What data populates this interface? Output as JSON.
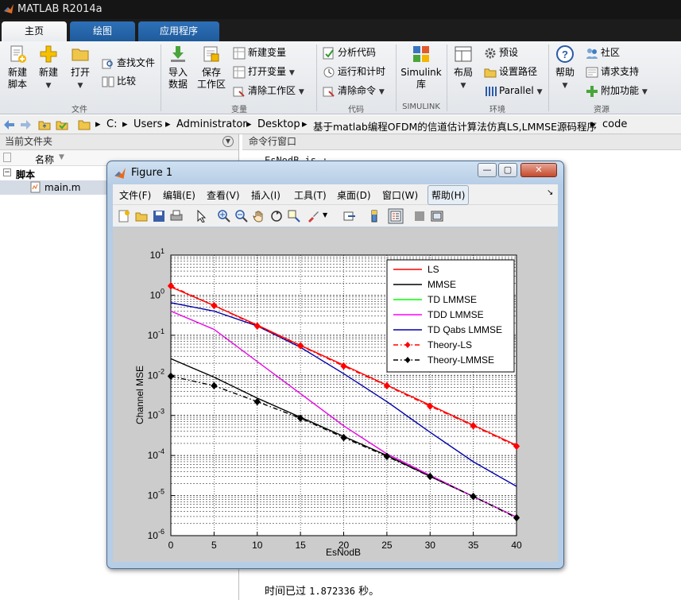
{
  "app": {
    "title": "MATLAB R2014a",
    "tabs": [
      {
        "label": "主页",
        "active": true
      },
      {
        "label": "绘图",
        "active": false
      },
      {
        "label": "应用程序",
        "active": false
      }
    ]
  },
  "ribbon": {
    "file": {
      "new_script": "新建\n脚本",
      "new": "新建",
      "open": "打开",
      "find_files": "查找文件",
      "compare": "比较",
      "group_label": "文件"
    },
    "variable": {
      "import": "导入\n数据",
      "save_ws": "保存\n工作区",
      "new_var": "新建变量",
      "open_var": "打开变量",
      "clear_ws": "清除工作区",
      "group_label": "变量"
    },
    "code": {
      "analyze": "分析代码",
      "run_time": "运行和计时",
      "clear_cmd": "清除命令",
      "group_label": "代码"
    },
    "simulink": {
      "lib": "Simulink\n库",
      "group_label": "SIMULINK"
    },
    "env": {
      "layout": "布局",
      "prefs": "预设",
      "set_path": "设置路径",
      "parallel": "Parallel",
      "group_label": "环境"
    },
    "resources": {
      "help": "帮助",
      "community": "社区",
      "request_support": "请求支持",
      "addons": "附加功能",
      "group_label": "资源"
    }
  },
  "address": {
    "crumbs": [
      "C:",
      "Users",
      "Administrator",
      "Desktop",
      "基于matlab编程OFDM的信道估计算法仿真LS,LMMSE源码程序",
      "code"
    ]
  },
  "left_panel": {
    "title": "当前文件夹",
    "col_name": "名称",
    "group": "脚本",
    "file": "main.m"
  },
  "command_window": {
    "title": "命令行窗口",
    "top_line": "EsNodB is :",
    "elapsed_label": "时间已过",
    "elapsed_value": "1.872336",
    "elapsed_unit": "秒。"
  },
  "figure": {
    "title": "Figure 1",
    "menu": [
      "文件(F)",
      "编辑(E)",
      "查看(V)",
      "插入(I)",
      "工具(T)",
      "桌面(D)",
      "窗口(W)",
      "帮助(H)"
    ]
  },
  "chart_data": {
    "type": "line",
    "xlabel": "EsNodB",
    "ylabel": "Channel MSE",
    "title": "",
    "xlim": [
      0,
      40
    ],
    "ylim_log10": [
      -6,
      1
    ],
    "yscale": "log",
    "grid": true,
    "legend_position": "top-right",
    "xticks": [
      0,
      5,
      10,
      15,
      20,
      25,
      30,
      35,
      40
    ],
    "series": [
      {
        "name": "LS",
        "color": "#ff0000",
        "style": "solid",
        "marker": "none",
        "x": [
          0,
          5,
          10,
          15,
          20,
          25,
          30,
          35,
          40
        ],
        "y": [
          1.6,
          0.55,
          0.18,
          0.056,
          0.018,
          0.0057,
          0.0018,
          0.00057,
          0.00018
        ]
      },
      {
        "name": "MMSE",
        "color": "#000000",
        "style": "solid",
        "marker": "none",
        "x": [
          0,
          5,
          10,
          15,
          20,
          25,
          30,
          35,
          40
        ],
        "y": [
          0.026,
          0.009,
          0.0027,
          0.0009,
          0.0003,
          0.0001,
          3e-05,
          9.5e-06,
          2.9e-06
        ]
      },
      {
        "name": "TD LMMSE",
        "color": "#00ff00",
        "style": "solid",
        "marker": "none",
        "x": [
          0,
          5,
          10,
          15,
          20,
          25,
          30,
          35,
          40
        ],
        "y": [
          0.4,
          0.14,
          0.022,
          0.0035,
          0.00055,
          0.00011,
          3.2e-05,
          9.5e-06,
          2.9e-06
        ]
      },
      {
        "name": "TDD LMMSE",
        "color": "#ff00ff",
        "style": "solid",
        "marker": "none",
        "x": [
          0,
          5,
          10,
          15,
          20,
          25,
          30,
          35,
          40
        ],
        "y": [
          0.4,
          0.14,
          0.022,
          0.0035,
          0.00055,
          0.00011,
          3.2e-05,
          9.5e-06,
          2.9e-06
        ]
      },
      {
        "name": "TD Qabs LMMSE",
        "color": "#0000aa",
        "style": "solid",
        "marker": "none",
        "x": [
          0,
          5,
          10,
          15,
          20,
          25,
          30,
          35,
          40
        ],
        "y": [
          0.65,
          0.4,
          0.17,
          0.05,
          0.011,
          0.0022,
          0.00038,
          7e-05,
          1.7e-05
        ]
      },
      {
        "name": "Theory-LS",
        "color": "#ff0000",
        "style": "dashdot",
        "marker": "diamond",
        "x": [
          0,
          5,
          10,
          15,
          20,
          25,
          30,
          35,
          40
        ],
        "y": [
          1.7,
          0.55,
          0.17,
          0.055,
          0.017,
          0.0055,
          0.0017,
          0.00055,
          0.00017
        ]
      },
      {
        "name": "Theory-LMMSE",
        "color": "#000000",
        "style": "dashdot",
        "marker": "diamond",
        "x": [
          0,
          5,
          10,
          15,
          20,
          25,
          30,
          35,
          40
        ],
        "y": [
          0.0095,
          0.0055,
          0.0022,
          0.00085,
          0.00028,
          9.5e-05,
          3e-05,
          9.5e-06,
          2.8e-06
        ]
      }
    ]
  }
}
